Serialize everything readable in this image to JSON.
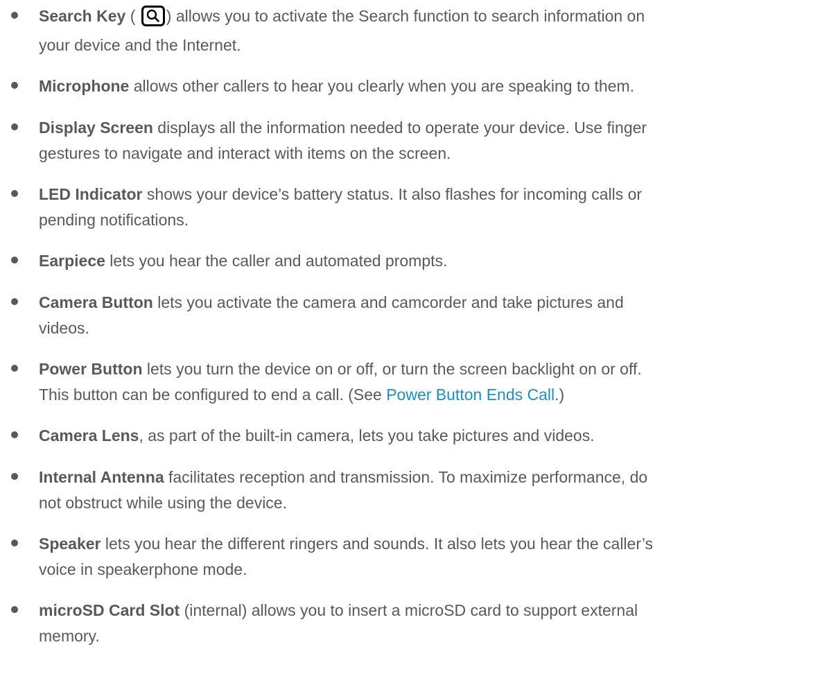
{
  "items": [
    {
      "term": "Search Key",
      "pre": " ( ",
      "post": ") allows you to activate the Search function to search information on",
      "line2": "your device and the Internet."
    },
    {
      "term": "Microphone",
      "line1": " allows other callers to hear you clearly when you are speaking to them."
    },
    {
      "term": "Display Screen",
      "line1": " displays all the information needed to operate your device. Use finger",
      "line2": "gestures to navigate and interact with items on the screen."
    },
    {
      "term": "LED Indicator",
      "line1": " shows your device’s battery status. It also flashes for incoming calls or",
      "line2": "pending notifications."
    },
    {
      "term": "Earpiece",
      "line1": " lets you hear the caller and automated prompts."
    },
    {
      "term": "Camera Button",
      "line1": " lets you activate the camera and camcorder and take pictures and",
      "line2": "videos."
    },
    {
      "term": "Power Button",
      "line1": " lets you turn the device on or off, or turn the screen backlight on or off.",
      "line2_pre": "This button can be configured to end a call. (See ",
      "link": "Power Button Ends Call",
      "line2_post": ".)"
    },
    {
      "term": "Camera Lens",
      "line1": ", as part of the built-in camera, lets you take pictures and videos."
    },
    {
      "term": "Internal Antenna",
      "line1": " facilitates reception and transmission. To maximize performance, do",
      "line2": "not obstruct while using the device."
    },
    {
      "term": "Speaker",
      "line1": " lets you hear the different ringers and sounds. It also lets you hear the caller’s",
      "line2": "voice in speakerphone mode."
    },
    {
      "term": "microSD Card Slot",
      "line1": " (internal) allows you to insert a microSD card to support external",
      "line2": "memory."
    }
  ],
  "icons": {
    "search_key": "search-key-icon"
  },
  "colors": {
    "text": "#595959",
    "link": "#1a8fc0"
  }
}
